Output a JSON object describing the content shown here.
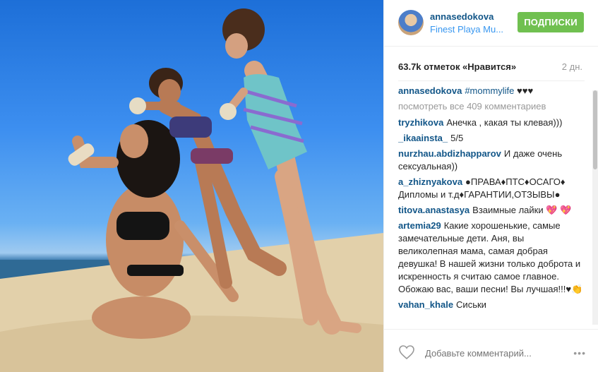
{
  "header": {
    "username": "annasedokova",
    "location": "Finest Playa Mu...",
    "follow_label": "ПОДПИСКИ"
  },
  "stats": {
    "likes": "63.7k отметок «Нравится»",
    "time": "2 дн."
  },
  "caption": {
    "user": "annasedokova",
    "tag": "#mommylife",
    "text": "♥♥♥"
  },
  "view_all": "посмотреть все 409 комментариев",
  "comments": [
    {
      "user": "tryzhikova",
      "text": "Анечка , какая ты клевая)))"
    },
    {
      "user": "_ikaainsta_",
      "text": "5/5"
    },
    {
      "user": "nurzhau.abdizhapparov",
      "text": "И даже очень сексуальная))"
    },
    {
      "user": "a_zhiznyakova",
      "text": "●ПРАВА♦ПТС♦ОСАГО♦ Дипломы и т.д♦ГАРАНТИИ,ОТЗЫВЫ●"
    },
    {
      "user": "titova.anastasya",
      "text": "Взаимные лайки 💖 💖"
    },
    {
      "user": "artemia29",
      "text": "Какие хорошенькие, самые замечательные дети. Аня, вы великолепная мама, самая добрая девушка! В нашей жизни только доброта и искренность я считаю самое главное. Обожаю вас, ваши песни! Вы лучшая!!!♥👏"
    },
    {
      "user": "vahan_khale",
      "text": "Сиськи"
    }
  ],
  "comment_bar": {
    "placeholder": "Добавьте комментарий...",
    "more": "•••"
  },
  "colors": {
    "username": "#125688",
    "location": "#3897f0",
    "follow_button": "#70c050",
    "muted": "#999999"
  }
}
